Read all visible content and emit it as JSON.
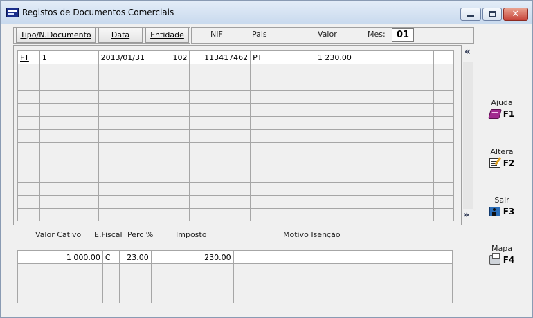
{
  "window": {
    "title": "Registos de Documentos Comerciais",
    "close_glyph": "✕"
  },
  "header": {
    "tipo_label": "Tipo/N.Documento",
    "data_label": "Data",
    "entidade_label": "Entidade",
    "nif_label": "NIF",
    "pais_label": "Pais",
    "valor_label": "Valor",
    "mes_label": "Mes:",
    "mes_value": "01"
  },
  "documents": {
    "rows": [
      {
        "tipo": "FT",
        "numero": "1",
        "data": "2013/01/31",
        "entidade": "102",
        "nif": "113417462",
        "pais": "PT",
        "valor": "1 230.00"
      }
    ],
    "total_rows": 13
  },
  "nav": {
    "up": "«",
    "down": "»"
  },
  "tax": {
    "labels": {
      "valor_cativo": "Valor Cativo",
      "e_fiscal": "E.Fiscal",
      "perc": "Perc %",
      "imposto": "Imposto",
      "motivo": "Motivo Isenção"
    },
    "rows": [
      {
        "valor_cativo": "1 000.00",
        "e_fiscal": "C",
        "perc": "23.00",
        "imposto": "230.00",
        "motivo": ""
      }
    ],
    "total_rows": 4
  },
  "fkeys": [
    {
      "label": "Ajuda",
      "key": "F1",
      "icon": "help-book-icon"
    },
    {
      "label": "Altera",
      "key": "F2",
      "icon": "edit-icon"
    },
    {
      "label": "Sair",
      "key": "F3",
      "icon": "exit-icon"
    },
    {
      "label": "Mapa",
      "key": "F4",
      "icon": "printer-icon"
    }
  ]
}
